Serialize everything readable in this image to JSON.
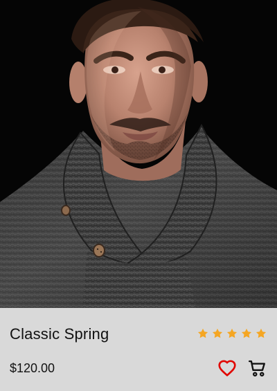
{
  "product": {
    "image_alt": "Man wearing a dark knit shawl-collar sweater",
    "title": "Classic Spring",
    "price": "$120.00",
    "rating": 5,
    "rating_max": 5
  },
  "icons": {
    "rating": "star-icon",
    "favorite": "heart-icon",
    "cart": "shopping-cart-icon"
  },
  "colors": {
    "star": "#f5a623",
    "heart": "#e10600",
    "cart": "#111111",
    "info_background": "#d9d9d9",
    "photo_background": "#050505"
  }
}
